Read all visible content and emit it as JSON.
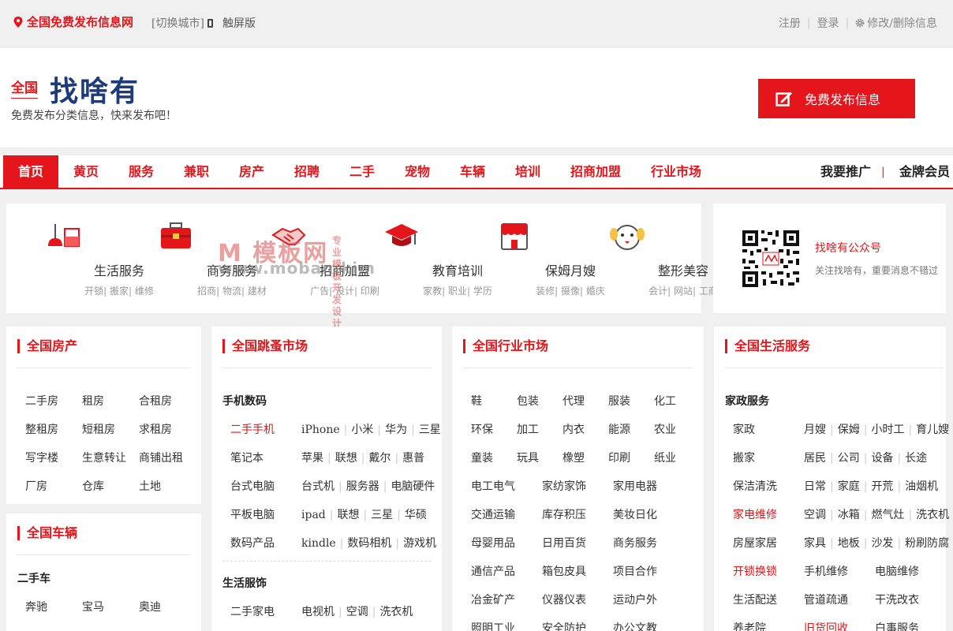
{
  "topbar": {
    "site_name": "全国免费发布信息网",
    "switch_city": "[切换城市]",
    "touch": "触屏版",
    "register": "注册",
    "login": "登录",
    "edit_info": "修改/删除信息"
  },
  "header": {
    "city": "全国",
    "logo": "找啥有",
    "slogan": "免费发布分类信息，快来发布吧！",
    "publish": "免费发布信息"
  },
  "nav": {
    "items": [
      "首页",
      "黄页",
      "服务",
      "兼职",
      "房产",
      "招聘",
      "二手",
      "宠物",
      "车辆",
      "培训",
      "招商加盟",
      "行业市场"
    ],
    "promote": "我要推广",
    "pipe": "|",
    "vip": "金牌会员"
  },
  "categories": [
    {
      "name": "生活服务",
      "subs": "开锁| 搬家| 维修",
      "icon": "cleaning-icon"
    },
    {
      "name": "商务服务",
      "subs": "招商| 物流| 建材",
      "icon": "toolbox-icon"
    },
    {
      "name": "招商加盟",
      "subs": "广告| 设计| 印刷",
      "icon": "handshake-icon"
    },
    {
      "name": "教育培训",
      "subs": "家教| 职业| 学历",
      "icon": "graduation-cap-icon"
    },
    {
      "name": "保姆月嫂",
      "subs": "装修| 摄像| 婚庆",
      "icon": "shop-icon"
    },
    {
      "name": "整形美容",
      "subs": "会计| 网站| 工商",
      "icon": "dog-face-icon"
    }
  ],
  "watermark": {
    "main": "M 模板网",
    "side1": "专业模板",
    "side2": "开发设计",
    "url": "www.moban.kim"
  },
  "wechat": {
    "title": "找啥有公众号",
    "desc": "关注找啥有，重要消息不错过"
  },
  "house": {
    "title": "全国房产",
    "rows": [
      [
        "二手房",
        "租房",
        "合租房"
      ],
      [
        "整租房",
        "短租房",
        "求租房"
      ],
      [
        "写字楼",
        "生意转让",
        "商铺出租"
      ],
      [
        "厂房",
        "仓库",
        "土地"
      ]
    ]
  },
  "vehicle": {
    "title": "全国车辆",
    "sub": "二手车",
    "rows": [
      [
        "奔驰",
        "宝马",
        "奥迪"
      ]
    ]
  },
  "flea": {
    "title": "全国跳蚤市场",
    "sub1": "手机数码",
    "rows1": [
      {
        "label": "二手手机",
        "red": true,
        "links": [
          "iPhone",
          "小米",
          "华为",
          "三星"
        ]
      },
      {
        "label": "笔记本",
        "red": false,
        "links": [
          "苹果",
          "联想",
          "戴尔",
          "惠普"
        ]
      },
      {
        "label": "台式电脑",
        "red": false,
        "links": [
          "台式机",
          "服务器",
          "电脑硬件"
        ]
      },
      {
        "label": "平板电脑",
        "red": false,
        "links": [
          "ipad",
          "联想",
          "三星",
          "华硕"
        ]
      },
      {
        "label": "数码产品",
        "red": false,
        "links": [
          "kindle",
          "数码相机",
          "游戏机"
        ]
      }
    ],
    "sub2": "生活服饰",
    "rows2": [
      {
        "label": "二手家电",
        "red": false,
        "links": [
          "电视机",
          "空调",
          "洗衣机"
        ]
      }
    ]
  },
  "industry": {
    "title": "全国行业市场",
    "rows5": [
      [
        "鞋",
        "包装",
        "代理",
        "服装",
        "化工"
      ],
      [
        "环保",
        "加工",
        "内衣",
        "能源",
        "农业"
      ],
      [
        "童装",
        "玩具",
        "橡塑",
        "印刷",
        "纸业"
      ]
    ],
    "rows3": [
      [
        "电工电气",
        "家纺家饰",
        "家用电器"
      ],
      [
        "交通运输",
        "库存积压",
        "美妆日化"
      ],
      [
        "母婴用品",
        "日用百货",
        "商务服务"
      ],
      [
        "通信产品",
        "箱包皮具",
        "项目合作"
      ],
      [
        "冶金矿产",
        "仪器仪表",
        "运动户外"
      ],
      [
        "照明工业",
        "安全防护",
        "办公文教"
      ]
    ]
  },
  "life": {
    "title": "全国生活服务",
    "sub": "家政服务",
    "rows": [
      {
        "label": "家政",
        "red": false,
        "links": [
          "月嫂",
          "保姆",
          "小时工",
          "育儿嫂"
        ]
      },
      {
        "label": "搬家",
        "red": false,
        "links": [
          "居民",
          "公司",
          "设备",
          "长途"
        ]
      },
      {
        "label": "保洁清洗",
        "red": false,
        "links": [
          "日常",
          "家庭",
          "开荒",
          "油烟机"
        ]
      },
      {
        "label": "家电维修",
        "red": true,
        "links": [
          "空调",
          "冰箱",
          "燃气灶",
          "洗衣机"
        ]
      },
      {
        "label": "房屋家居",
        "red": false,
        "links": [
          "家具",
          "地板",
          "沙发",
          "粉刷防腐"
        ]
      }
    ],
    "rows3": [
      [
        "开锁换锁",
        "手机维修",
        "电脑维修"
      ],
      [
        "生活配送",
        "管道疏通",
        "干洗改衣"
      ],
      [
        "养老院",
        "旧货回收",
        "白事服务"
      ]
    ],
    "red_cells": [
      "开锁换锁",
      "旧货回收"
    ]
  },
  "colors": {
    "accent": "#e4151b",
    "logo": "#1d3a7a"
  }
}
